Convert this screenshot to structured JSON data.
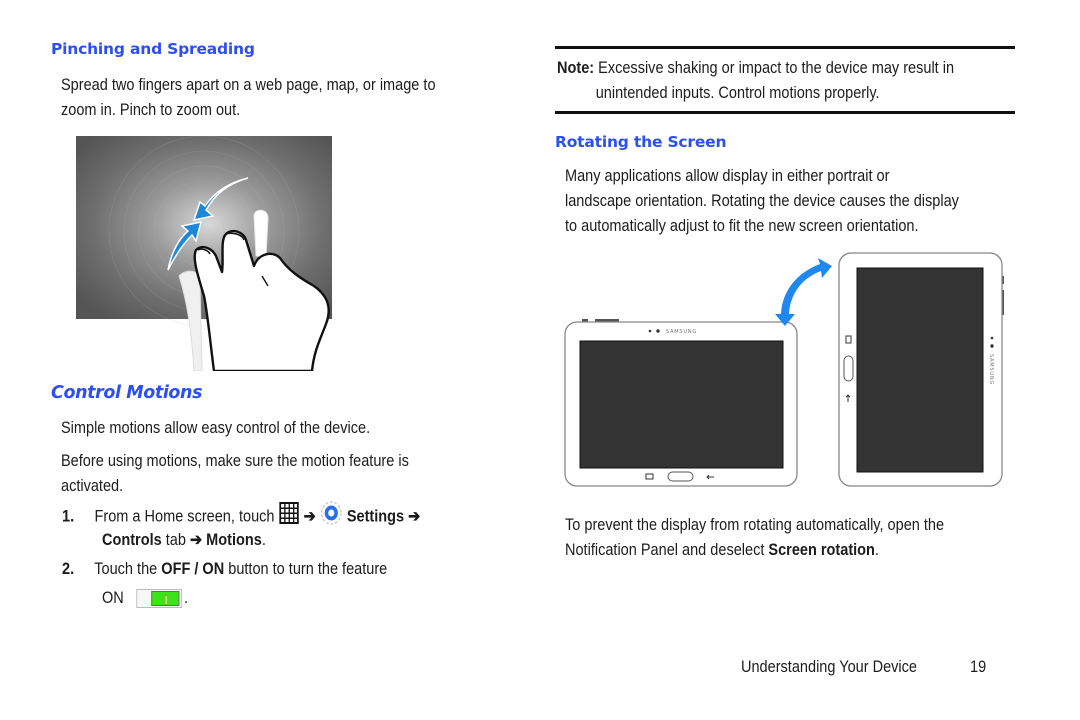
{
  "left_column": {
    "pinching": {
      "heading": "Pinching and Spreading",
      "body_line1": "Spread two fingers apart on a web page, map, or image to",
      "body_line2": "zoom in. Pinch to zoom out.",
      "illustration": "pinch-gesture-illustration"
    },
    "control_motions": {
      "heading": "Control Motions",
      "intro": "Simple motions allow easy control of the device.",
      "note_line1": "Before using motions, make sure the motion feature is",
      "note_line2": "activated.",
      "steps": [
        {
          "number": "1.",
          "text_before": "From a Home screen, touch",
          "apps_icon": "apps-grid-icon",
          "arrow1": "➔",
          "settings_icon": "settings-gear-icon",
          "settings_label": "Settings",
          "arrow2": "➔",
          "controls_label": "Controls",
          "tab_text": "tab",
          "arrow3": "➔",
          "motions_label": "Motions",
          "period": "."
        },
        {
          "number": "2.",
          "text_before": "Touch the",
          "off_on_label": "OFF / ON",
          "text_after": "button to turn the feature",
          "on_label": "ON",
          "toggle_state": "on",
          "period": "."
        }
      ]
    }
  },
  "right_column": {
    "note": {
      "label": "Note:",
      "line1": "Excessive shaking or impact to the device may result in",
      "line2": "unintended inputs. Control motions properly."
    },
    "rotating": {
      "heading": "Rotating the Screen",
      "body_line1": "Many applications allow display in either portrait or",
      "body_line2": "landscape orientation. Rotating the device causes the display",
      "body_line3": "to automatically adjust to fit the new screen orientation.",
      "illustration": "tablet-rotation-illustration",
      "brand_text": "SAMSUNG",
      "after_line1": "To prevent the display from rotating automatically, open the",
      "after_line2_before": "Notification Panel and deselect",
      "after_line2_bold": "Screen rotation",
      "after_line2_end": "."
    }
  },
  "footer": {
    "section": "Understanding Your Device",
    "page_number": "19"
  },
  "colors": {
    "heading_blue": "#2d4ff0",
    "arrow_blue": "#1e88d8",
    "toggle_green": "#3ee21a"
  }
}
